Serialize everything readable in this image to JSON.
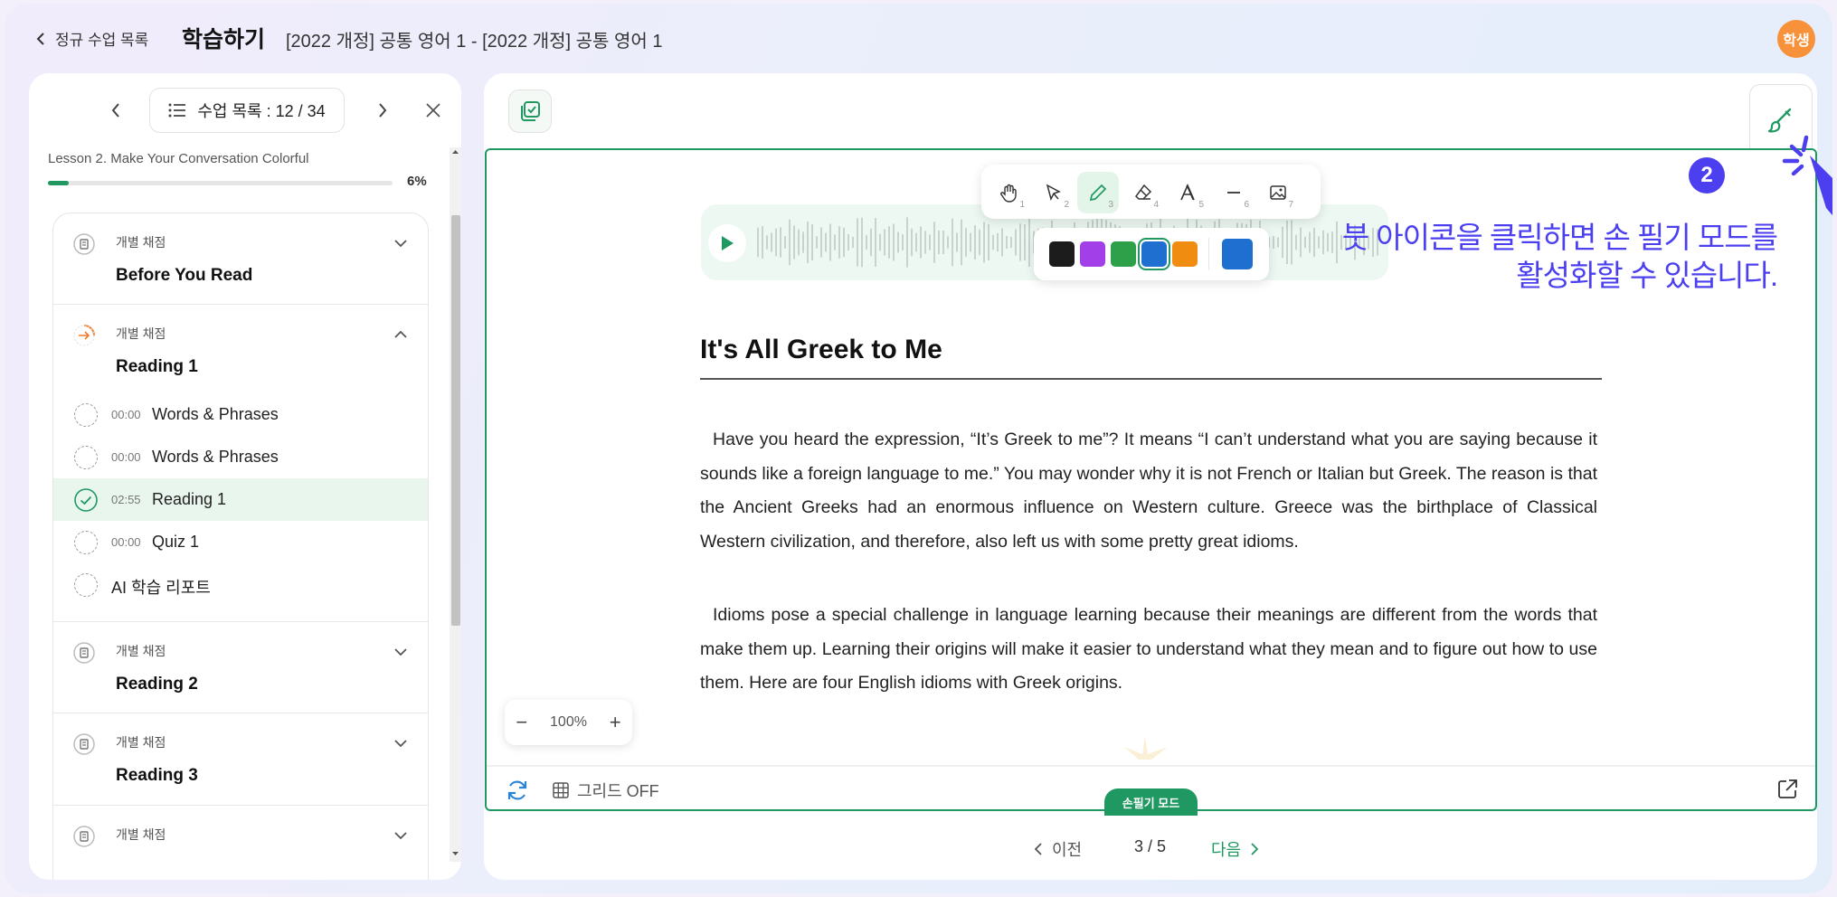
{
  "topbar": {
    "back_label": "정규 수업 목록",
    "page_title": "학습하기",
    "breadcrumb": "[2022 개정] 공통 영어 1 - [2022 개정] 공통 영어 1",
    "avatar_label": "학생"
  },
  "sidebar": {
    "list_label": "수업 목록 : 12 / 34",
    "lesson": "Lesson 2. Make Your Conversation Colorful",
    "progress_label": "6%",
    "progress_value": 0.06,
    "sections": [
      {
        "mode": "개별 채점",
        "title": "Before You Read",
        "expanded": false
      },
      {
        "mode": "개별 채점",
        "title": "Reading 1",
        "expanded": true,
        "items": [
          {
            "time": "00:00",
            "label": "Words & Phrases",
            "done": false
          },
          {
            "time": "00:00",
            "label": "Words & Phrases",
            "done": false
          },
          {
            "time": "02:55",
            "label": "Reading 1",
            "done": true,
            "active": true
          },
          {
            "time": "00:00",
            "label": "Quiz 1",
            "done": false
          },
          {
            "time": "",
            "label": "AI 학습 리포트",
            "done": false
          }
        ]
      },
      {
        "mode": "개별 채점",
        "title": "Reading 2",
        "expanded": false
      },
      {
        "mode": "개별 채점",
        "title": "Reading 3",
        "expanded": false
      },
      {
        "mode": "개별 채점",
        "title": "",
        "expanded": false
      }
    ]
  },
  "toolbar": {
    "tools": [
      {
        "icon": "hand-icon",
        "num": "1"
      },
      {
        "icon": "pointer-icon",
        "num": "2"
      },
      {
        "icon": "pen-icon",
        "num": "3",
        "active": true
      },
      {
        "icon": "eraser-icon",
        "num": "4"
      },
      {
        "icon": "text-icon",
        "num": "5"
      },
      {
        "icon": "line-icon",
        "num": "6"
      },
      {
        "icon": "image-icon",
        "num": "7"
      }
    ],
    "colors": [
      "#1c1c1c",
      "#a23fe8",
      "#2ea04a",
      "#1f6fd1",
      "#f08c10"
    ],
    "selected_color": "#1f6fd1",
    "current_color": "#1f6fd1"
  },
  "hint": {
    "badge": "2",
    "line1": "붓 아이콘을 클릭하면 손 필기 모드를",
    "line2": "활성화할 수 있습니다."
  },
  "article": {
    "title": "It's All Greek to Me",
    "paragraphs": [
      "Have you heard the expression, “It’s Greek to me”? It means “I can’t understand what you are saying because it sounds like a foreign language to me.” You may wonder why it is not French or Italian but Greek. The reason is that the Ancient Greeks had an enormous influence on Western culture. Greece was the birthplace of Classical Western civilization, and therefore, also left us with some pretty great idioms.",
      "Idioms pose a special challenge in language learning because their meanings are different from the words that make them up. Learning their origins will make it easier to understand what they mean and to figure out how to use them. Here are four English idioms with Greek origins."
    ]
  },
  "zoom": {
    "minus": "−",
    "value": "100%",
    "plus": "+"
  },
  "footer": {
    "grid_label": "그리드 OFF",
    "mode_label": "손필기 모드",
    "prev_label": "이전",
    "page_indicator": "3 / 5",
    "next_label": "다음"
  },
  "colors": {
    "accent": "#1f9961",
    "hint": "#4b3ff0",
    "avatar": "#f7923a"
  }
}
